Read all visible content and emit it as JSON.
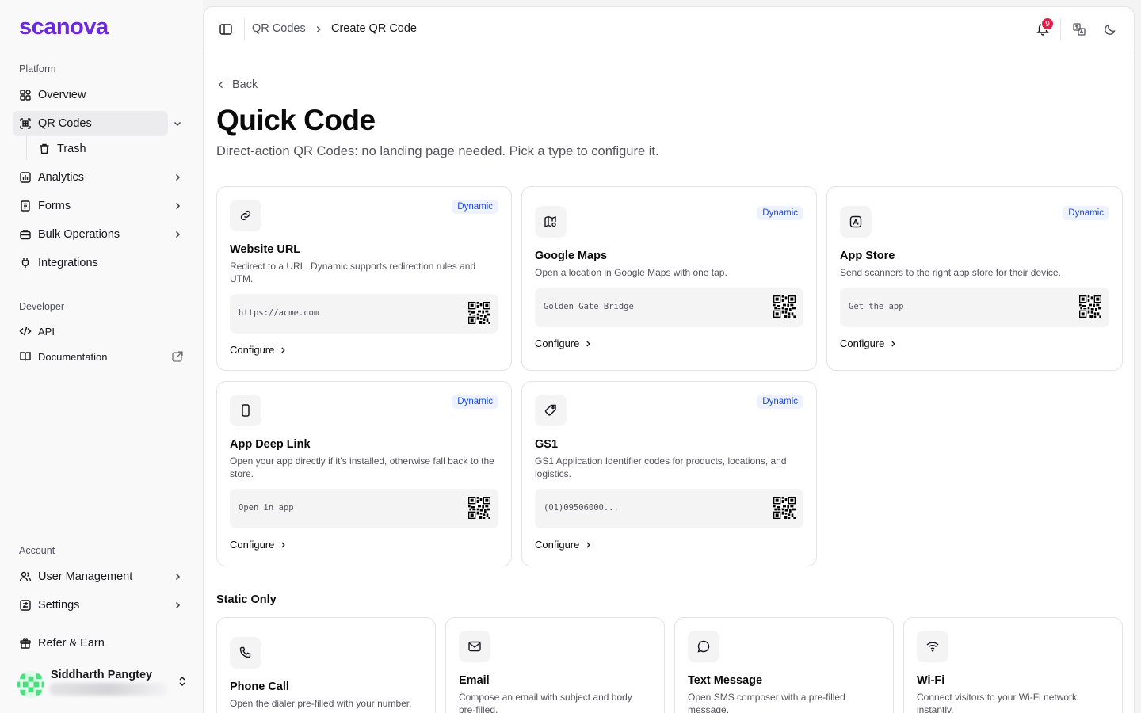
{
  "brand": {
    "name": "scanova",
    "color": "#6d28d9"
  },
  "sidebar": {
    "platform_label": "Platform",
    "items": [
      {
        "label": "Overview",
        "icon": "overview-icon"
      },
      {
        "label": "QR Codes",
        "icon": "qr-scan-icon",
        "active": true
      },
      {
        "label": "Trash",
        "icon": "trash-icon"
      },
      {
        "label": "Analytics",
        "icon": "chart-icon"
      },
      {
        "label": "Forms",
        "icon": "forms-icon"
      },
      {
        "label": "Bulk Operations",
        "icon": "briefcase-icon"
      },
      {
        "label": "Integrations",
        "icon": "plug-icon"
      }
    ],
    "developer_label": "Developer",
    "developer_items": [
      {
        "label": "API",
        "icon": "code-icon"
      },
      {
        "label": "Documentation",
        "icon": "book-icon"
      }
    ],
    "account_label": "Account",
    "account_items": [
      {
        "label": "User Management",
        "icon": "users-icon"
      },
      {
        "label": "Settings",
        "icon": "settings-icon"
      },
      {
        "label": "Refer & Earn",
        "icon": "gift-icon"
      }
    ],
    "user": {
      "name": "Siddharth Pangtey"
    }
  },
  "topbar": {
    "breadcrumb": [
      "QR Codes",
      "Create QR Code"
    ],
    "notifications": "9"
  },
  "main": {
    "back_label": "Back",
    "title": "Quick Code",
    "subtitle": "Direct-action QR Codes: no landing page needed. Pick a type to configure it.",
    "dynamic_cards": [
      {
        "title": "Website URL",
        "badge": "Dynamic",
        "desc": "Redirect to a URL. Dynamic supports redirection rules and UTM.",
        "preview": "https://acme.com",
        "configure": "Configure",
        "icon": "link-icon"
      },
      {
        "title": "Google Maps",
        "badge": "Dynamic",
        "desc": "Open a location in Google Maps with one tap.",
        "preview": "Golden Gate Bridge",
        "configure": "Configure",
        "icon": "map-icon"
      },
      {
        "title": "App Store",
        "badge": "Dynamic",
        "desc": "Send scanners to the right app store for their device.",
        "preview": "Get the app",
        "configure": "Configure",
        "icon": "app-store-icon"
      },
      {
        "title": "App Deep Link",
        "badge": "Dynamic",
        "desc": "Open your app directly if it's installed, otherwise fall back to the store.",
        "preview": "Open in app",
        "configure": "Configure",
        "icon": "phone-device-icon"
      },
      {
        "title": "GS1",
        "badge": "Dynamic",
        "desc": "GS1 Application Identifier codes for products, locations, and logistics.",
        "preview": "(01)09506000...",
        "configure": "Configure",
        "icon": "tag-icon"
      }
    ],
    "static_label": "Static Only",
    "static_cards": [
      {
        "title": "Phone Call",
        "desc": "Open the dialer pre-filled with your number.",
        "icon": "phone-icon"
      },
      {
        "title": "Email",
        "desc": "Compose an email with subject and body pre-filled.",
        "icon": "mail-icon"
      },
      {
        "title": "Text Message",
        "desc": "Open SMS composer with a pre-filled message.",
        "icon": "message-icon"
      },
      {
        "title": "Wi-Fi",
        "desc": "Connect visitors to your Wi-Fi network instantly.",
        "icon": "wifi-icon"
      }
    ]
  }
}
